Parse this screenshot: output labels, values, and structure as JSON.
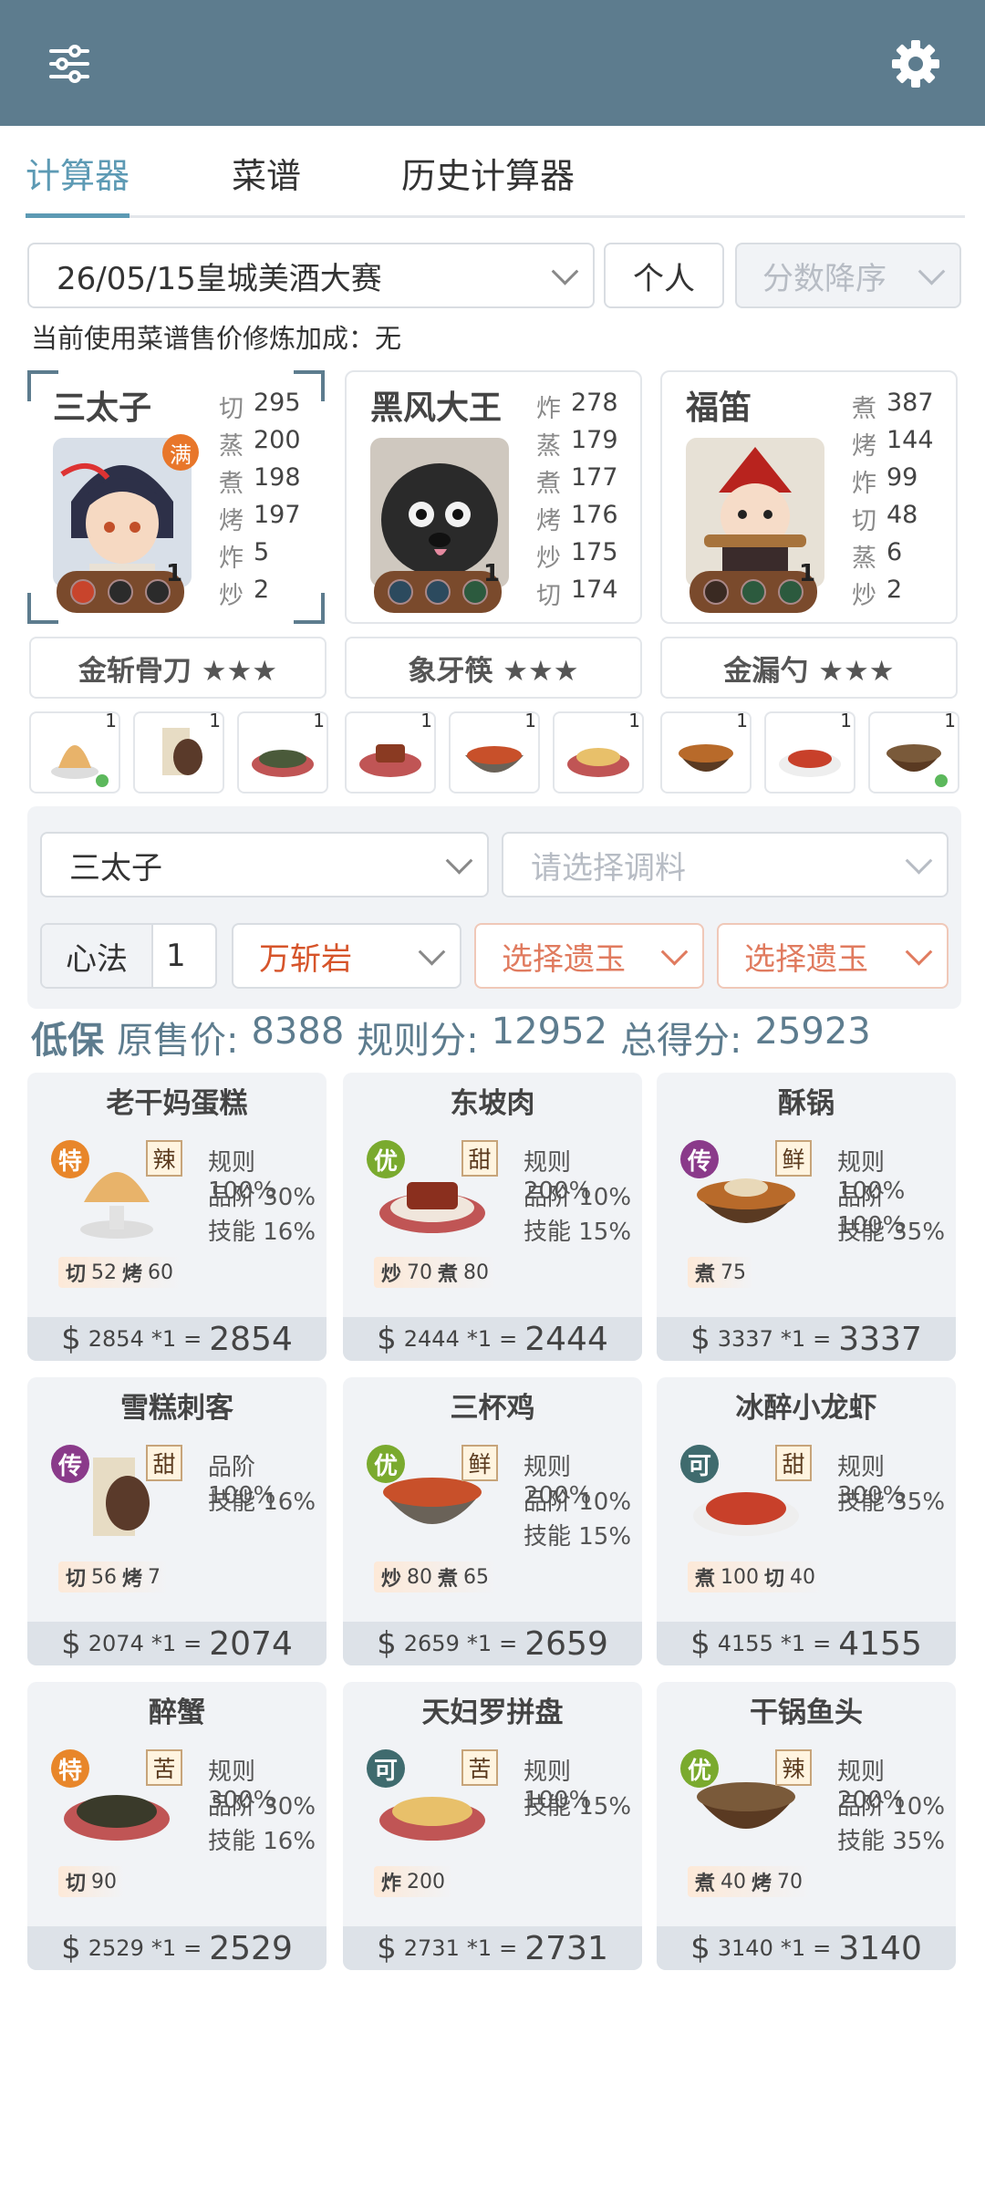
{
  "colors": {
    "accent": "#5d9ab4",
    "topbar": "#5d7c8e",
    "grade_te": "#e8862a",
    "grade_you": "#7aaa2e",
    "grade_chuan": "#8a3a8a",
    "grade_ke": "#3f6b6e"
  },
  "icons": {
    "menu": "sliders-icon",
    "settings": "gear-icon"
  },
  "tabs": [
    "计算器",
    "菜谱",
    "历史计算器"
  ],
  "filters": {
    "event": "26/05/15皇城美酒大赛",
    "mode": "个人",
    "sort": "分数降序"
  },
  "note": "当前使用菜谱售价修炼加成：无",
  "chefs": [
    {
      "name": "三太子",
      "badge": "满",
      "level": "1",
      "skills": [
        {
          "k": "切",
          "v": "295"
        },
        {
          "k": "蒸",
          "v": "200"
        },
        {
          "k": "煮",
          "v": "198"
        },
        {
          "k": "烤",
          "v": "197"
        },
        {
          "k": "炸",
          "v": "5"
        },
        {
          "k": "炒",
          "v": "2"
        }
      ],
      "equip": "金斩骨刀 ★★★"
    },
    {
      "name": "黑风大王",
      "badge": "",
      "level": "1",
      "skills": [
        {
          "k": "炸",
          "v": "278"
        },
        {
          "k": "蒸",
          "v": "179"
        },
        {
          "k": "煮",
          "v": "177"
        },
        {
          "k": "烤",
          "v": "176"
        },
        {
          "k": "炒",
          "v": "175"
        },
        {
          "k": "切",
          "v": "174"
        }
      ],
      "equip": "象牙筷 ★★★"
    },
    {
      "name": "福笛",
      "badge": "",
      "level": "1",
      "skills": [
        {
          "k": "煮",
          "v": "387"
        },
        {
          "k": "烤",
          "v": "144"
        },
        {
          "k": "炸",
          "v": "99"
        },
        {
          "k": "切",
          "v": "48"
        },
        {
          "k": "蒸",
          "v": "6"
        },
        {
          "k": "炒",
          "v": "2"
        }
      ],
      "equip": "金漏勺 ★★★"
    }
  ],
  "dish_slots": [
    "1",
    "1",
    "1",
    "1",
    "1",
    "1",
    "1",
    "1",
    "1"
  ],
  "panel": {
    "chef_select": "三太子",
    "seasoning_placeholder": "请选择调料",
    "xinfa_label": "心法",
    "xinfa_value": "1",
    "jade_main": "万斩岩",
    "jade_1": "选择遗玉",
    "jade_2": "选择遗玉"
  },
  "summary": {
    "low": "低保",
    "orig_label": "原售价:",
    "orig": "8388",
    "rule_label": "规则分:",
    "rule": "12952",
    "total_label": "总得分:",
    "total": "25923"
  },
  "recipes": [
    {
      "name": "老干妈蛋糕",
      "grade": "特",
      "taste": "辣",
      "rules": [
        "规则 100%",
        "品阶 30%",
        "技能 16%"
      ],
      "need": [
        {
          "k": "切",
          "v": "52"
        },
        {
          "k": "烤",
          "v": "60"
        }
      ],
      "price": "2854",
      "mult": "*1",
      "total": "2854"
    },
    {
      "name": "东坡肉",
      "grade": "优",
      "taste": "甜",
      "rules": [
        "规则 200%",
        "品阶 10%",
        "技能 15%"
      ],
      "need": [
        {
          "k": "炒",
          "v": "70"
        },
        {
          "k": "煮",
          "v": "80"
        }
      ],
      "price": "2444",
      "mult": "*1",
      "total": "2444"
    },
    {
      "name": "酥锅",
      "grade": "传",
      "taste": "鲜",
      "rules": [
        "规则 100%",
        "品阶 100%",
        "技能 35%"
      ],
      "need": [
        {
          "k": "煮",
          "v": "75"
        }
      ],
      "price": "3337",
      "mult": "*1",
      "total": "3337"
    },
    {
      "name": "雪糕刺客",
      "grade": "传",
      "taste": "甜",
      "rules": [
        "品阶 100%",
        "技能 16%"
      ],
      "need": [
        {
          "k": "切",
          "v": "56"
        },
        {
          "k": "烤",
          "v": "7"
        }
      ],
      "price": "2074",
      "mult": "*1",
      "total": "2074"
    },
    {
      "name": "三杯鸡",
      "grade": "优",
      "taste": "鲜",
      "rules": [
        "规则 200%",
        "品阶 10%",
        "技能 15%"
      ],
      "need": [
        {
          "k": "炒",
          "v": "80"
        },
        {
          "k": "煮",
          "v": "65"
        }
      ],
      "price": "2659",
      "mult": "*1",
      "total": "2659"
    },
    {
      "name": "冰醉小龙虾",
      "grade": "可",
      "taste": "甜",
      "rules": [
        "规则 300%",
        "技能 35%"
      ],
      "need": [
        {
          "k": "煮",
          "v": "100"
        },
        {
          "k": "切",
          "v": "40"
        }
      ],
      "price": "4155",
      "mult": "*1",
      "total": "4155"
    },
    {
      "name": "醉蟹",
      "grade": "特",
      "taste": "苦",
      "rules": [
        "规则 300%",
        "品阶 30%",
        "技能 16%"
      ],
      "need": [
        {
          "k": "切",
          "v": "90"
        }
      ],
      "price": "2529",
      "mult": "*1",
      "total": "2529"
    },
    {
      "name": "天妇罗拼盘",
      "grade": "可",
      "taste": "苦",
      "rules": [
        "规则 100%",
        "技能 15%"
      ],
      "need": [
        {
          "k": "炸",
          "v": "200"
        }
      ],
      "price": "2731",
      "mult": "*1",
      "total": "2731"
    },
    {
      "name": "干锅鱼头",
      "grade": "优",
      "taste": "辣",
      "rules": [
        "规则 200%",
        "品阶 10%",
        "技能 35%"
      ],
      "need": [
        {
          "k": "煮",
          "v": "40"
        },
        {
          "k": "烤",
          "v": "70"
        }
      ],
      "price": "3140",
      "mult": "*1",
      "total": "3140"
    }
  ]
}
